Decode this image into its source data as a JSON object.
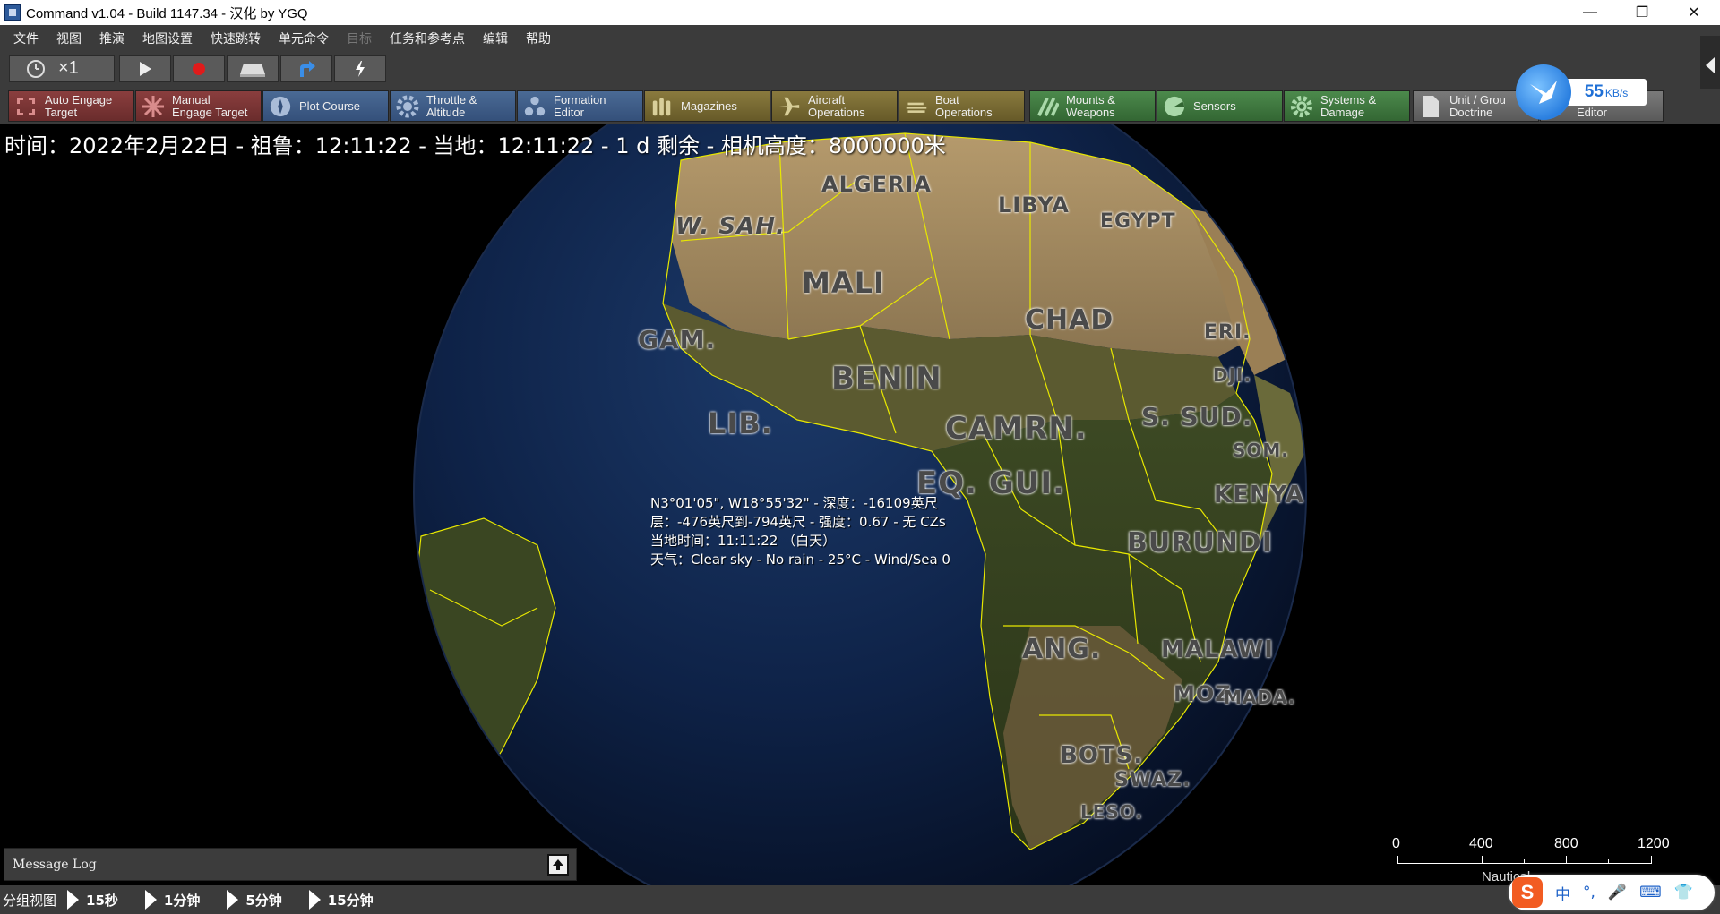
{
  "titlebar": {
    "title": "Command v1.04 - Build 1147.34 - 汉化 by YGQ",
    "minimize": "—",
    "restore": "❐",
    "close": "✕"
  },
  "menu": [
    "文件",
    "视图",
    "推演",
    "地图设置",
    "快速跳转",
    "单元命令",
    "目标",
    "任务和参考点",
    "编辑",
    "帮助"
  ],
  "speedbar": {
    "speed_label": "×1"
  },
  "function_buttons": [
    {
      "label": "Auto Engage\nTarget",
      "color": "#8a3e3e"
    },
    {
      "label": "Manual\nEngage Target",
      "color": "#8a3e3e"
    },
    {
      "label": "Plot Course",
      "color": "#4a6a95"
    },
    {
      "label": "Throttle &\nAltitude",
      "color": "#4a6a95"
    },
    {
      "label": "Formation\nEditor",
      "color": "#4a6a95"
    },
    {
      "label": "Magazines",
      "color": "#8a7a3e"
    },
    {
      "label": "Aircraft\nOperations",
      "color": "#8a7a3e"
    },
    {
      "label": "Boat\nOperations",
      "color": "#8a7a3e"
    },
    {
      "label": "Mounts &\nWeapons",
      "color": "#4c8a4c"
    },
    {
      "label": "Sensors",
      "color": "#4c8a4c"
    },
    {
      "label": "Systems &\nDamage",
      "color": "#4c8a4c"
    },
    {
      "label": "Unit / Grou\nDoctrine",
      "color": "#7a7a7a"
    },
    {
      "label": "\nEditor",
      "color": "#7a7a7a"
    }
  ],
  "map": {
    "status": "时间：2022年2月22日 - 祖鲁：12:11:22 - 当地：12:11:22 - 1 d 剩余 - 相机高度：8000000米",
    "countries": [
      "ALGERIA",
      "LIBYA",
      "EGYPT",
      "W. SAH.",
      "MALI",
      "CHAD",
      "GAM.",
      "BENIN",
      "LIB.",
      "CAMRN.",
      "S. SUD.",
      "EQ. GUI.",
      "KENYA",
      "BURUNDI",
      "ANG.",
      "MALAWI",
      "MOZ.",
      "BOTS.",
      "SWAZ.",
      "LESO.",
      "ERI.",
      "DJI.",
      "SOM.",
      "MADA."
    ],
    "cursor_info": {
      "line1": "N3°01'05\", W18°55'32\" - 深度：-16109英尺",
      "line2": "层：-476英尺到-794英尺 - 强度：0.67 - 无 CZs",
      "line3": "当地时间：11:11:22 （白天）",
      "line4": "天气：Clear sky - No rain - 25°C - Wind/Sea 0"
    },
    "message_log": "Message Log",
    "scale": {
      "labels": [
        "0",
        "400",
        "800",
        "1200"
      ],
      "unit": "Nautical"
    }
  },
  "bottombar": {
    "group_view": "分组视图",
    "time_buttons": [
      "15秒",
      "1分钟",
      "5分钟",
      "15分钟"
    ]
  },
  "net_widget": {
    "speed": "55",
    "unit": "KB/s"
  },
  "ime": {
    "logo": "S",
    "items": [
      "中",
      "°,",
      "🎤",
      "⌨",
      "👕"
    ]
  }
}
